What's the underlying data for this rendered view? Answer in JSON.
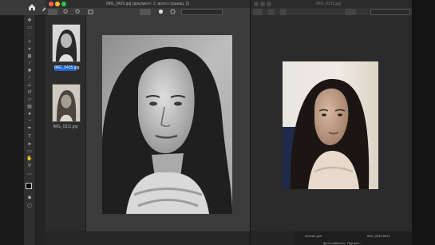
{
  "left_window": {
    "title": "IMG_0425.jpg (документ: 3, всего страниц: 2)",
    "thumbnails": [
      {
        "label": "IMG_0435.jpg",
        "selected": true
      },
      {
        "label": "IMG_0311.jpg",
        "selected": false
      }
    ]
  },
  "right_window": {
    "title": "IMG_0311.jpg"
  },
  "bottom_bar": {
    "files": [
      "отложи\nура",
      "фото рабочего",
      "Портрет...",
      "IMG_0040.MOV"
    ]
  },
  "colors": {
    "selection": "#1e63c9",
    "traffic_red": "#ff5f57",
    "traffic_yellow": "#febc2e",
    "traffic_green": "#28c840"
  },
  "icons": [
    "home-icon",
    "brush-icon",
    "zoom-in-icon",
    "zoom-out-icon",
    "hand-icon",
    "rotate-icon",
    "search-icon"
  ]
}
